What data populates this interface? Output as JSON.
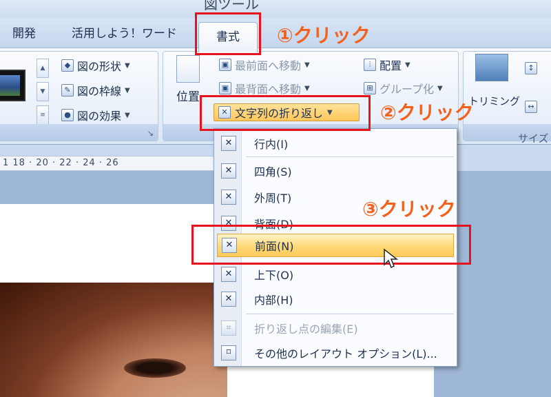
{
  "title_bar": {
    "tool_title": "図ツール"
  },
  "tabs": [
    {
      "label": "開発"
    },
    {
      "label": "活用しよう！ワード"
    },
    {
      "label": "書式",
      "active": true
    }
  ],
  "ribbon": {
    "picture_styles": {
      "shape": "図の形状",
      "border": "図の枠線",
      "effect": "図の効果"
    },
    "arrange": {
      "position": "位置",
      "bring_front": "最前面へ移動",
      "send_back": "最背面へ移動",
      "text_wrap": "文字列の折り返し",
      "align": "配置",
      "group": "グループ化"
    },
    "size": {
      "trimming": "トリミング",
      "group_label": "サイズ"
    }
  },
  "ruler": {
    "ticks": "1 18 · 20 · 22 · 24 · 26"
  },
  "wrap_menu": {
    "items": [
      {
        "label": "行内(I)",
        "enabled": true
      },
      {
        "label": "四角(S)",
        "enabled": true
      },
      {
        "label": "外周(T)",
        "enabled": true
      },
      {
        "label": "背面(D)",
        "enabled": true
      },
      {
        "label": "前面(N)",
        "enabled": true,
        "highlighted": true
      },
      {
        "label": "上下(O)",
        "enabled": true
      },
      {
        "label": "内部(H)",
        "enabled": true
      },
      {
        "label": "折り返し点の編集(E)",
        "enabled": false
      },
      {
        "label": "その他のレイアウト オプション(L)...",
        "enabled": true
      }
    ]
  },
  "annotations": {
    "step1": "①クリック",
    "step2": "②クリック",
    "step3": "③クリック",
    "color": "#e8121d",
    "text_color": "#f3611c"
  }
}
